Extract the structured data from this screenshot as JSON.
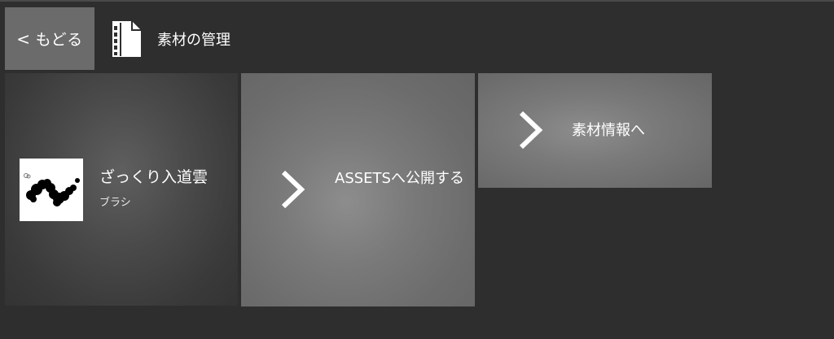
{
  "header": {
    "back_chevron": "<",
    "back_label": "もどる",
    "title": "素材の管理",
    "title_icon": "document-icon"
  },
  "asset": {
    "name": "ざっくり入道雲",
    "type": "ブラシ",
    "thumbnail_icon": "cloud-brush-thumbnail"
  },
  "actions": {
    "publish_label": "ASSETSへ公開する",
    "info_label": "素材情報へ",
    "chevron_icon": "chevron-right-icon"
  },
  "colors": {
    "background": "#2e2e2e",
    "back_button": "#6b6b6b",
    "tile_light": "#7a7a7a",
    "tile_dark": "#3a3a3a"
  }
}
